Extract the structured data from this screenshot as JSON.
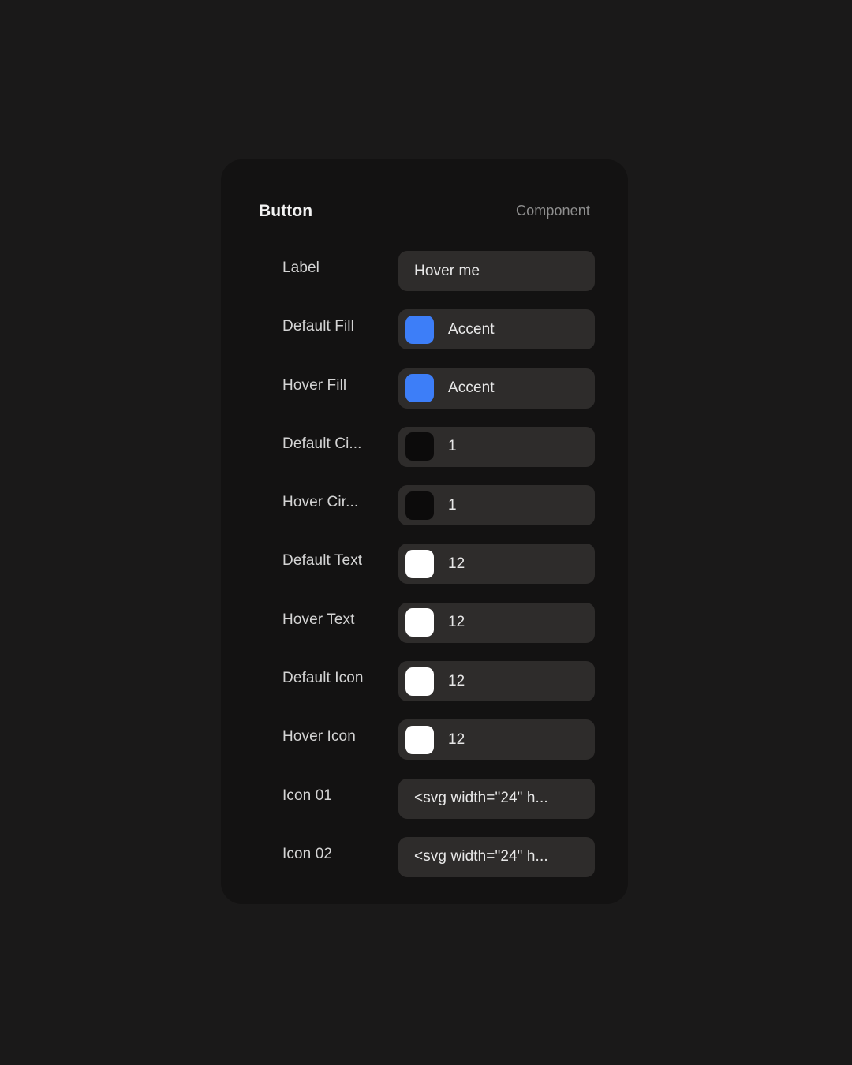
{
  "page": {
    "background": "#1a1919"
  },
  "card": {
    "background": "#131212",
    "header": {
      "title": "Button",
      "kind": "Component"
    },
    "rows": [
      {
        "label": "Label",
        "type": "text",
        "value": "Hover me"
      },
      {
        "label": "Default Fill",
        "type": "color",
        "swatch": "#3d7ef8",
        "value": "Accent"
      },
      {
        "label": "Hover Fill",
        "type": "color",
        "swatch": "#3d7ef8",
        "value": "Accent"
      },
      {
        "label": "Default Ci...",
        "type": "color",
        "swatch": "#0c0b0b",
        "value": "1"
      },
      {
        "label": "Hover Cir...",
        "type": "color",
        "swatch": "#0c0b0b",
        "value": "1"
      },
      {
        "label": "Default Text",
        "type": "color",
        "swatch": "#ffffff",
        "value": "12"
      },
      {
        "label": "Hover Text",
        "type": "color",
        "swatch": "#ffffff",
        "value": "12"
      },
      {
        "label": "Default Icon",
        "type": "color",
        "swatch": "#ffffff",
        "value": "12"
      },
      {
        "label": "Hover Icon",
        "type": "color",
        "swatch": "#ffffff",
        "value": "12"
      },
      {
        "label": "Icon 01",
        "type": "text",
        "value": "<svg width=\"24\" h..."
      },
      {
        "label": "Icon 02",
        "type": "text",
        "value": "<svg width=\"24\" h..."
      }
    ]
  }
}
